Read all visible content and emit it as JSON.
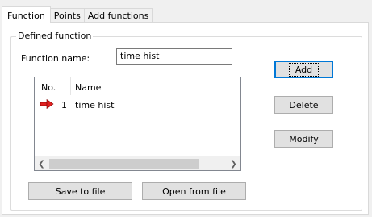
{
  "tabs": [
    {
      "label": "Function",
      "active": true
    },
    {
      "label": "Points",
      "active": false
    },
    {
      "label": "Add functions",
      "active": false
    }
  ],
  "group": {
    "title": "Defined function"
  },
  "function_name": {
    "label": "Function name:",
    "value": "time hist"
  },
  "list": {
    "columns": [
      "No.",
      "Name"
    ],
    "rows": [
      {
        "no": "1",
        "name": "time hist",
        "marker": "red-arrow-icon"
      }
    ]
  },
  "buttons": {
    "add": "Add",
    "delete": "Delete",
    "modify": "Modify",
    "save": "Save to file",
    "open": "Open from file"
  },
  "colors": {
    "selection_arrow": "#e02020",
    "default_button_border": "#0078d7"
  }
}
